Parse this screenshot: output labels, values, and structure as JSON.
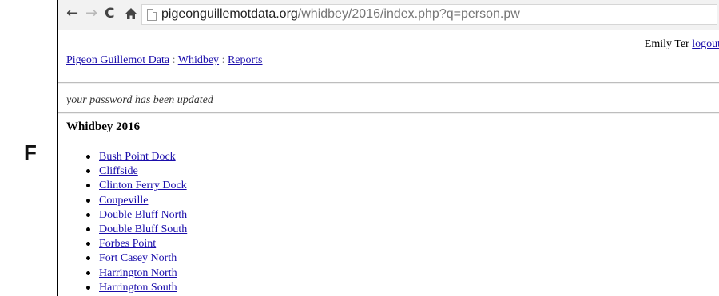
{
  "figure": {
    "panel_label": "F"
  },
  "browser": {
    "url_domain": "pigeonguillemotdata.org",
    "url_path": "/whidbey/2016/index.php?q=person.pw"
  },
  "user": {
    "name": "Emily Ter",
    "logout_label": "logout"
  },
  "breadcrumb": {
    "items": [
      "Pigeon Guillemot Data",
      "Whidbey",
      "Reports"
    ],
    "separator": ":"
  },
  "status_message": "your password has been updated",
  "section_title": "Whidbey 2016",
  "sites": [
    "Bush Point Dock",
    "Cliffside",
    "Clinton Ferry Dock",
    "Coupeville",
    "Double Bluff North",
    "Double Bluff South",
    "Forbes Point",
    "Fort Casey North",
    "Harrington North",
    "Harrington South"
  ]
}
